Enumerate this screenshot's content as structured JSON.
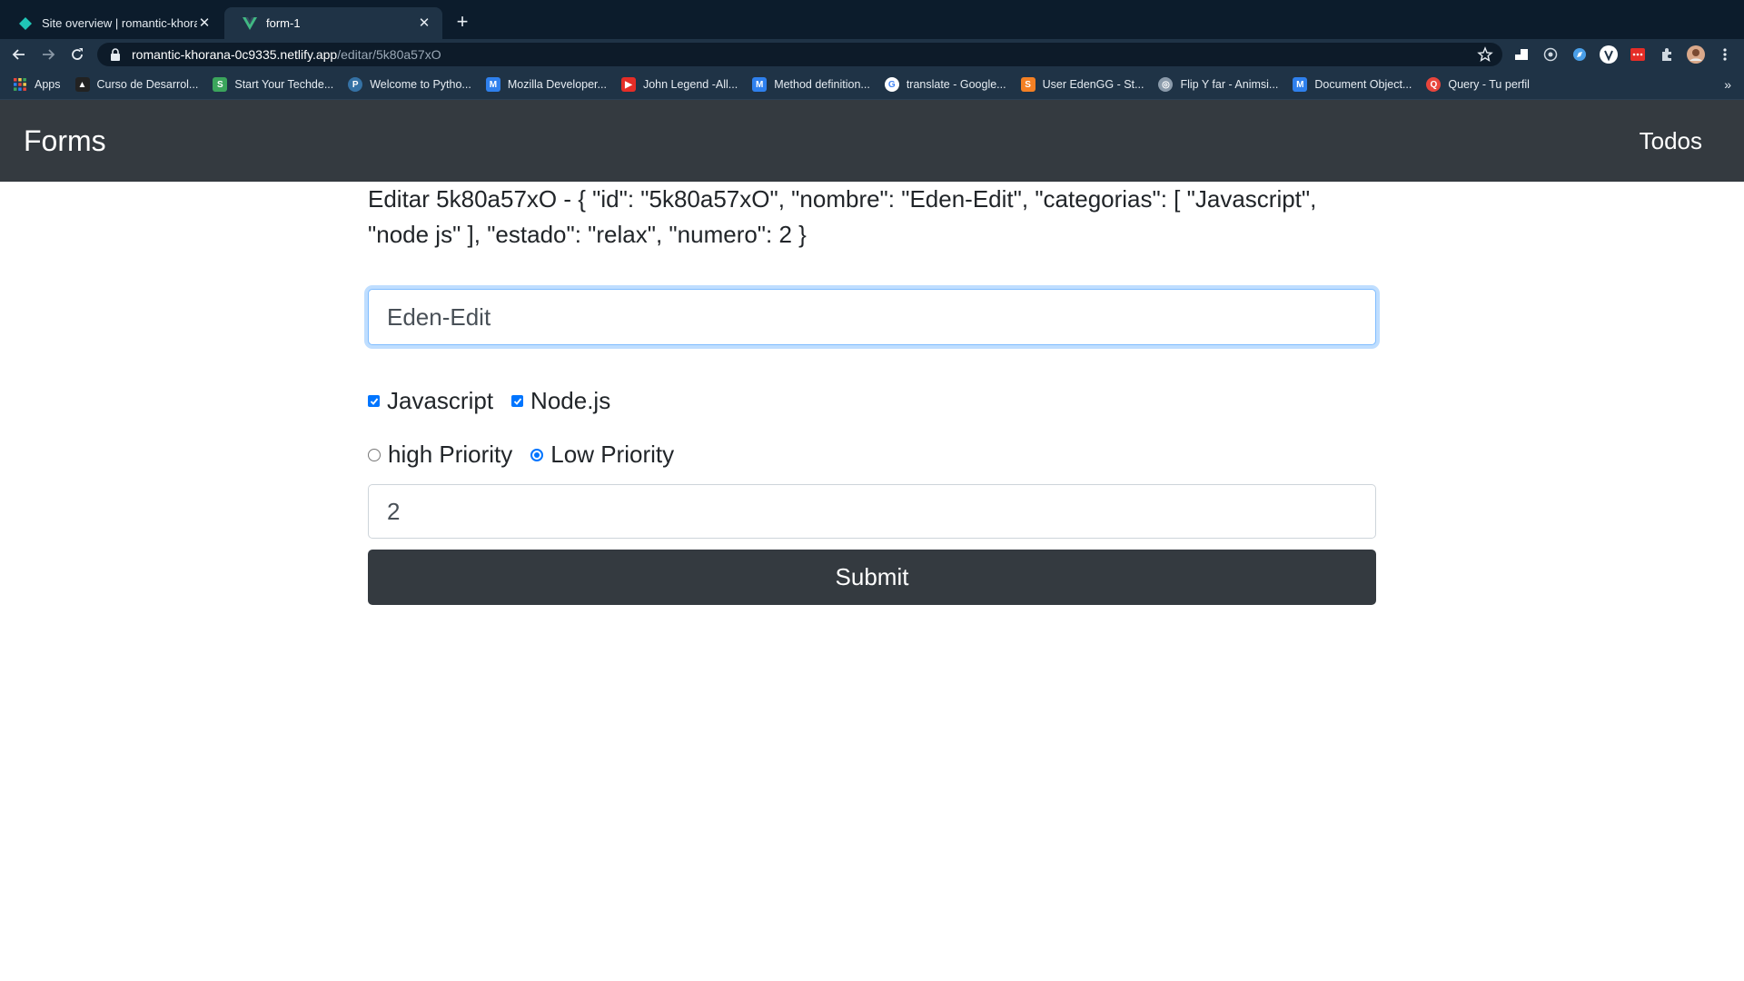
{
  "browser": {
    "tabs": [
      {
        "title": "Site overview | romantic-khora",
        "icon": "netlify-icon"
      },
      {
        "title": "form-1",
        "icon": "vue-icon"
      }
    ],
    "url_host": "romantic-khorana-0c9335.netlify.app",
    "url_path": "/editar/5k80a57xO",
    "bookmarks": [
      {
        "label": "Apps",
        "color": "#e8453c"
      },
      {
        "label": "Curso de Desarrol...",
        "color": "#222222"
      },
      {
        "label": "Start Your Techde...",
        "color": "#3ba55c"
      },
      {
        "label": "Welcome to Pytho...",
        "color": "#f2c94c"
      },
      {
        "label": "Mozilla Developer...",
        "color": "#2f80ed"
      },
      {
        "label": "John Legend -All...",
        "color": "#e52d27"
      },
      {
        "label": "Method definition...",
        "color": "#2f80ed"
      },
      {
        "label": "translate - Google...",
        "color": "#ffffff"
      },
      {
        "label": "User EdenGG - St...",
        "color": "#f48024"
      },
      {
        "label": "Flip Y far - Animsi...",
        "color": "#8a9aaa"
      },
      {
        "label": "Document Object...",
        "color": "#2f80ed"
      },
      {
        "label": "Query - Tu perfil",
        "color": "#e8453c"
      }
    ],
    "bookmarks_more": "»"
  },
  "nav": {
    "brand": "Forms",
    "link": "Todos"
  },
  "form": {
    "heading": "Editar 5k80a57xO - { \"id\": \"5k80a57xO\", \"nombre\": \"Eden-Edit\", \"categorias\": [ \"Javascript\", \"node js\" ], \"estado\": \"relax\", \"numero\": 2 }",
    "name_value": "Eden-Edit",
    "checkboxes": [
      {
        "label": "Javascript",
        "checked": true
      },
      {
        "label": "Node.js",
        "checked": true
      }
    ],
    "radios": [
      {
        "label": "high Priority",
        "selected": false
      },
      {
        "label": "Low Priority",
        "selected": true
      }
    ],
    "number_value": "2",
    "submit_label": "Submit"
  },
  "colors": {
    "navbar": "#343a40",
    "accent": "#0075ff",
    "focus": "#80bdff"
  }
}
